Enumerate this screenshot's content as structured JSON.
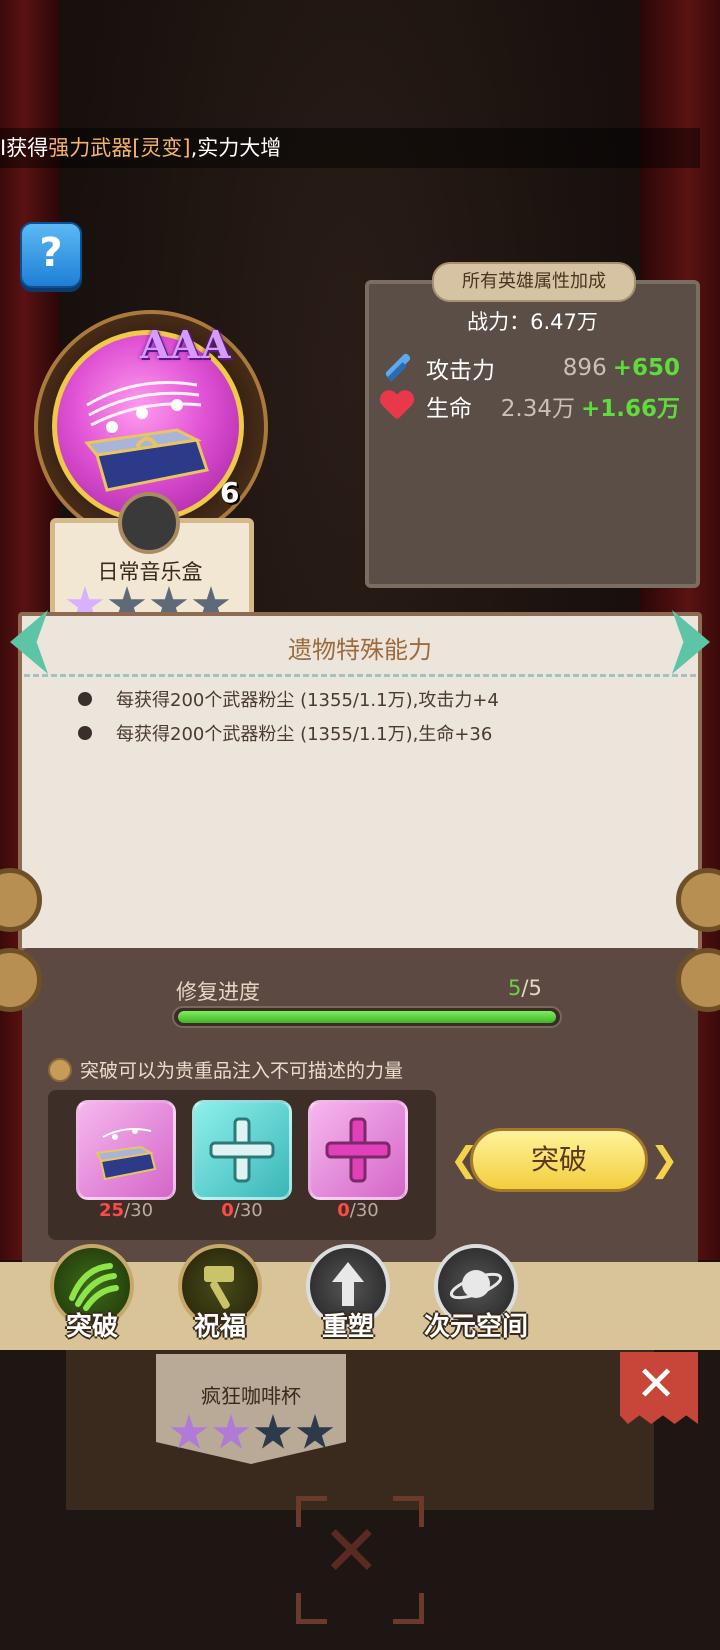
{
  "ticker": {
    "prefix": "I",
    "text1": "获得",
    "highlight": "强力武器[灵变]",
    "text2": ",实力大增"
  },
  "help": {
    "icon": "?"
  },
  "relic": {
    "grade": "AAA",
    "level": "6",
    "name": "日常音乐盒",
    "stars_filled": 1,
    "stars_total": 4
  },
  "attributes": {
    "title": "所有英雄属性加成",
    "power_label": "战力：6.47万",
    "stats": [
      {
        "icon": "sword-icon",
        "label": "攻击力",
        "value": "896",
        "bonus": "+650"
      },
      {
        "icon": "heart-icon",
        "label": "生命",
        "value": "2.34万",
        "bonus": "+1.66万"
      }
    ]
  },
  "ability": {
    "title": "遗物特殊能力",
    "items": [
      "每获得200个武器粉尘 (1355/1.1万),攻击力+4",
      "每获得200个武器粉尘 (1355/1.1万),生命+36"
    ]
  },
  "repair": {
    "label": "修复进度",
    "current": "5",
    "total": "/5",
    "progress": 1.0
  },
  "breakthrough": {
    "hint": "突破可以为贵重品注入不可描述的力量",
    "materials": [
      {
        "name": "music-box-material",
        "have": "25",
        "need": "/30"
      },
      {
        "name": "teal-cross-material",
        "have": "0",
        "need": "/30"
      },
      {
        "name": "pink-cross-material",
        "have": "0",
        "need": "/30"
      }
    ],
    "button_label": "突破",
    "left_chevron": "❮",
    "right_chevron": "❯"
  },
  "tabs": [
    {
      "label": "突破",
      "icon": "claw-icon"
    },
    {
      "label": "祝福",
      "icon": "hammer-icon"
    },
    {
      "label": "重塑",
      "icon": "reshape-icon"
    },
    {
      "label": "次元空间",
      "icon": "planet-icon"
    }
  ],
  "bottom": {
    "relic_name": "疯狂咖啡杯",
    "close_icon": "✕",
    "empty_slot_icon": "✕"
  }
}
